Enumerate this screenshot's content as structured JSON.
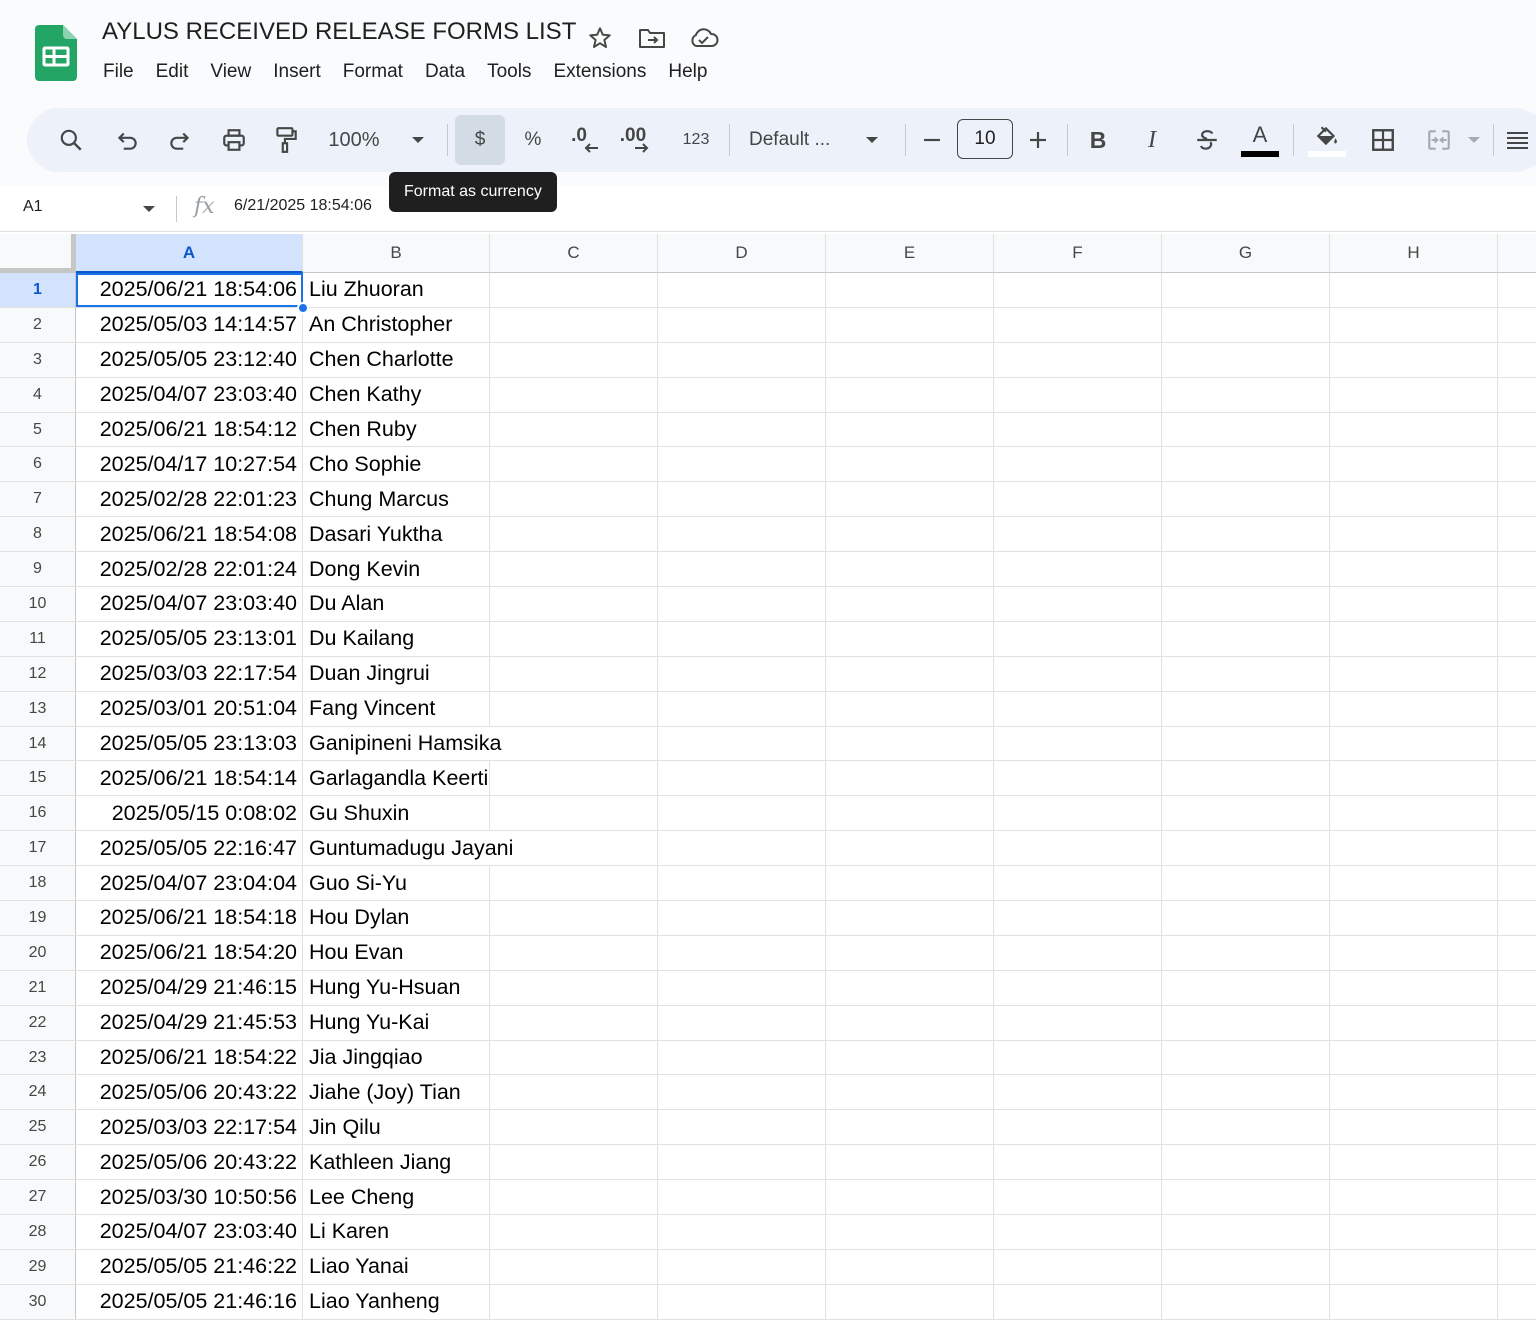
{
  "app": {
    "title": "AYLUS RECEIVED RELEASE FORMS LIST",
    "menu": [
      "File",
      "Edit",
      "View",
      "Insert",
      "Format",
      "Data",
      "Tools",
      "Extensions",
      "Help"
    ]
  },
  "toolbar": {
    "zoom": "100%",
    "currency_label": "$",
    "percent_label": "%",
    "decrease_decimal_label": ".0",
    "increase_decimal_label": ".00",
    "more_formats_label": "123",
    "font_family": "Default ...",
    "font_size": "10",
    "bold_label": "B",
    "italic_label": "I",
    "text_color_label": "A"
  },
  "tooltip": {
    "text": "Format as currency"
  },
  "formula_bar": {
    "cell_ref": "A1",
    "value": "6/21/2025 18:54:06"
  },
  "grid": {
    "columns": [
      "A",
      "B",
      "C",
      "D",
      "E",
      "F",
      "G",
      "H"
    ],
    "selected_column": "A",
    "selected_row": 1,
    "rows": [
      {
        "num": "1",
        "a": "2025/06/21 18:54:06",
        "b": "Liu Zhuoran"
      },
      {
        "num": "2",
        "a": "2025/05/03 14:14:57",
        "b": "An Christopher"
      },
      {
        "num": "3",
        "a": "2025/05/05 23:12:40",
        "b": "Chen Charlotte"
      },
      {
        "num": "4",
        "a": "2025/04/07 23:03:40",
        "b": "Chen Kathy"
      },
      {
        "num": "5",
        "a": "2025/06/21 18:54:12",
        "b": "Chen Ruby"
      },
      {
        "num": "6",
        "a": "2025/04/17 10:27:54",
        "b": "Cho Sophie"
      },
      {
        "num": "7",
        "a": "2025/02/28 22:01:23",
        "b": "Chung Marcus"
      },
      {
        "num": "8",
        "a": "2025/06/21 18:54:08",
        "b": "Dasari Yuktha"
      },
      {
        "num": "9",
        "a": "2025/02/28 22:01:24",
        "b": "Dong Kevin"
      },
      {
        "num": "10",
        "a": "2025/04/07 23:03:40",
        "b": "Du Alan"
      },
      {
        "num": "11",
        "a": "2025/05/05 23:13:01",
        "b": "Du Kailang"
      },
      {
        "num": "12",
        "a": "2025/03/03 22:17:54",
        "b": "Duan Jingrui"
      },
      {
        "num": "13",
        "a": "2025/03/01 20:51:04",
        "b": "Fang Vincent"
      },
      {
        "num": "14",
        "a": "2025/05/05 23:13:03",
        "b": "Ganipineni Hamsika"
      },
      {
        "num": "15",
        "a": "2025/06/21 18:54:14",
        "b": "Garlagandla Keerti"
      },
      {
        "num": "16",
        "a": "2025/05/15 0:08:02",
        "b": "Gu Shuxin"
      },
      {
        "num": "17",
        "a": "2025/05/05 22:16:47",
        "b": "Guntumadugu Jayani"
      },
      {
        "num": "18",
        "a": "2025/04/07 23:04:04",
        "b": "Guo Si-Yu"
      },
      {
        "num": "19",
        "a": "2025/06/21 18:54:18",
        "b": "Hou Dylan"
      },
      {
        "num": "20",
        "a": "2025/06/21 18:54:20",
        "b": "Hou Evan"
      },
      {
        "num": "21",
        "a": "2025/04/29 21:46:15",
        "b": "Hung Yu-Hsuan"
      },
      {
        "num": "22",
        "a": "2025/04/29 21:45:53",
        "b": "Hung Yu-Kai"
      },
      {
        "num": "23",
        "a": "2025/06/21 18:54:22",
        "b": "Jia Jingqiao"
      },
      {
        "num": "24",
        "a": "2025/05/06 20:43:22",
        "b": "Jiahe (Joy) Tian"
      },
      {
        "num": "25",
        "a": "2025/03/03 22:17:54",
        "b": "Jin Qilu"
      },
      {
        "num": "26",
        "a": "2025/05/06 20:43:22",
        "b": "Kathleen Jiang"
      },
      {
        "num": "27",
        "a": "2025/03/30 10:50:56",
        "b": "Lee Cheng"
      },
      {
        "num": "28",
        "a": "2025/04/07 23:03:40",
        "b": "Li Karen"
      },
      {
        "num": "29",
        "a": "2025/05/05 21:46:22",
        "b": "Liao Yanai"
      },
      {
        "num": "30",
        "a": "2025/05/05 21:46:16",
        "b": "Liao Yanheng"
      }
    ]
  },
  "colors": {
    "accent": "#1a73e8",
    "sheets_green": "#23a566",
    "selection_header": "#d3e3fd"
  }
}
